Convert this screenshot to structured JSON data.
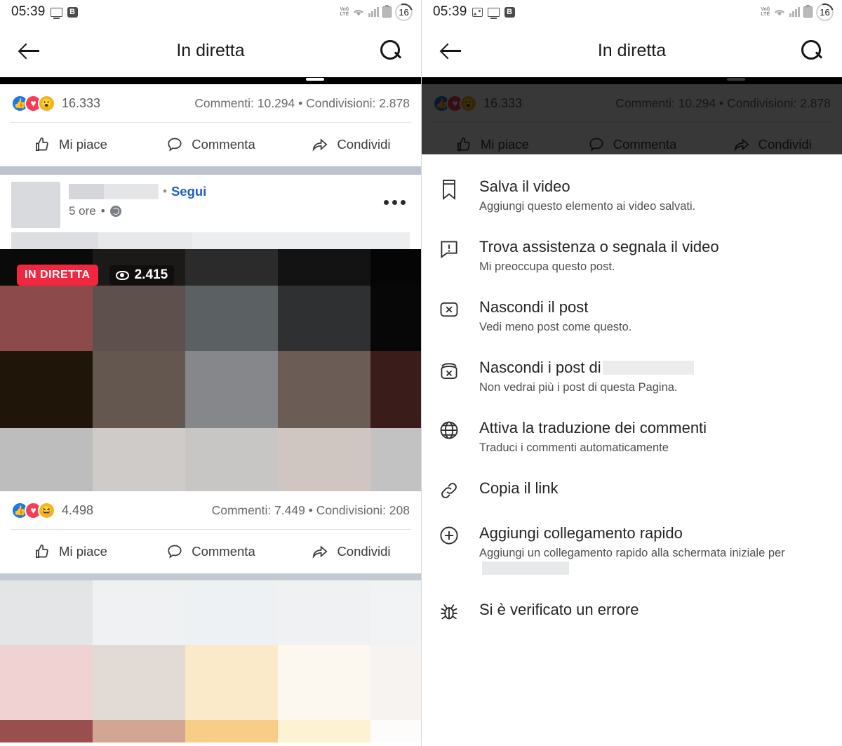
{
  "status_bar": {
    "time": "05:39",
    "left_icons_left_panel": [
      "monitor-icon",
      "bold-b-icon"
    ],
    "left_icons_right_panel": [
      "photo-icon",
      "monitor-icon",
      "bold-b-icon"
    ],
    "bold_letter": "B",
    "volte_line1": "VoI)",
    "volte_line2": "LTE",
    "battery_level": "16"
  },
  "appbar": {
    "title": "In diretta",
    "back_icon": "back-arrow-icon",
    "search_icon": "search-icon"
  },
  "post_top": {
    "reactions": [
      {
        "name": "like-reaction",
        "glyph": "👍",
        "color": "#1877f2"
      },
      {
        "name": "love-reaction",
        "glyph": "♥",
        "color": "#f33e58"
      },
      {
        "name": "wow-reaction",
        "glyph": "😮",
        "color": "#f7b125"
      }
    ],
    "reaction_count": "16.333",
    "meta": "Commenti: 10.294 • Condivisioni: 2.878",
    "actions": [
      {
        "name": "like-button",
        "label": "Mi piace",
        "icon": "thumbs-up-icon"
      },
      {
        "name": "comment-button",
        "label": "Commenta",
        "icon": "comment-bubble-icon"
      },
      {
        "name": "share-button",
        "label": "Condividi",
        "icon": "share-arrow-icon"
      }
    ]
  },
  "post_mid": {
    "header": {
      "author_redacted": true,
      "separator": "•",
      "follow_label": "Segui",
      "timestamp": "5 ore",
      "privacy_icon": "globe-icon",
      "menu_icon": "overflow-menu-icon"
    },
    "video": {
      "live_badge": "IN DIRETTA",
      "viewers": "2.415",
      "viewers_icon": "eye-icon",
      "tile_colors": [
        [
          "#0b0a0a",
          "#1c1a19",
          "#2b2b2b",
          "#131313",
          "#050505"
        ],
        [
          "#8c4a4a",
          "#5e504c",
          "#5b6063",
          "#2e3031",
          "#070707"
        ],
        [
          "#1f1509",
          "#635750",
          "#85878a",
          "#6b5c55",
          "#3a1d1b"
        ],
        [
          "#bdbdbd",
          "#cfcbc8",
          "#c8c6c4",
          "#cfc6c2",
          "#c2c2c2"
        ]
      ]
    },
    "reactions": [
      {
        "name": "like-reaction",
        "glyph": "👍",
        "color": "#1877f2"
      },
      {
        "name": "love-reaction",
        "glyph": "♥",
        "color": "#f33e58"
      },
      {
        "name": "haha-reaction",
        "glyph": "😆",
        "color": "#f7b125"
      }
    ],
    "reaction_count": "4.498",
    "meta": "Commenti: 7.449 • Condivisioni: 208",
    "actions": [
      {
        "name": "like-button",
        "label": "Mi piace",
        "icon": "thumbs-up-icon"
      },
      {
        "name": "comment-button",
        "label": "Commenta",
        "icon": "comment-bubble-icon"
      },
      {
        "name": "share-button",
        "label": "Condividi",
        "icon": "share-arrow-icon"
      }
    ]
  },
  "post_bottom": {
    "photo_tile_colors": [
      [
        "#e2e4e5",
        "#eef0f1",
        "#eef1f2",
        "#eff1f2",
        "#f1f2f3"
      ],
      [
        "#e3e5e6",
        "#eff1f2",
        "#eef1f3",
        "#f0f1f3",
        "#f2f3f4"
      ],
      [
        "#f0d2d3",
        "#e2dad4",
        "#fbeaca",
        "#fdf8ef",
        "#f6f3f0"
      ],
      [
        "#9a4f4f",
        "#d2a693",
        "#f7cd88",
        "#fdf2d2",
        "#fdfcfa"
      ]
    ]
  },
  "menu_sheet": {
    "items": [
      {
        "name": "menu-item-save-video",
        "icon": "bookmark-icon",
        "title": "Salva il video",
        "subtitle": "Aggiungi questo elemento ai video salvati.",
        "redacted_title": false,
        "redacted_subtitle": false
      },
      {
        "name": "menu-item-report-video",
        "icon": "report-bubble-icon",
        "title": "Trova assistenza o segnala il video",
        "subtitle": "Mi preoccupa questo post.",
        "redacted_title": false,
        "redacted_subtitle": false
      },
      {
        "name": "menu-item-hide-post",
        "icon": "hide-x-box-icon",
        "title": "Nascondi il post",
        "subtitle": "Vedi meno post come questo.",
        "redacted_title": false,
        "redacted_subtitle": false
      },
      {
        "name": "menu-item-hide-all-posts",
        "icon": "snooze-x-box-icon",
        "title": "Nascondi i post di",
        "subtitle": "Non vedrai più i post di questa Pagina.",
        "redacted_title": true,
        "redacted_subtitle": false
      },
      {
        "name": "menu-item-translate-comments",
        "icon": "globe-icon",
        "title": "Attiva la traduzione dei commenti",
        "subtitle": "Traduci i commenti automaticamente",
        "redacted_title": false,
        "redacted_subtitle": false
      },
      {
        "name": "menu-item-copy-link",
        "icon": "link-chain-icon",
        "title": "Copia il link",
        "subtitle": "",
        "redacted_title": false,
        "redacted_subtitle": false
      },
      {
        "name": "menu-item-add-shortcut",
        "icon": "plus-circle-icon",
        "title": "Aggiungi collegamento rapido",
        "subtitle": "Aggiungi un collegamento rapido alla schermata iniziale per",
        "redacted_title": false,
        "redacted_subtitle": true
      },
      {
        "name": "menu-item-error",
        "icon": "bug-icon",
        "title": "Si è verificato un errore",
        "subtitle": "",
        "redacted_title": false,
        "redacted_subtitle": false
      }
    ]
  },
  "colors": {
    "facebook_blue": "#1877f2",
    "live_red": "#f0273f",
    "follow_link": "#2160c0",
    "divider_gray": "#c3c9d2"
  }
}
